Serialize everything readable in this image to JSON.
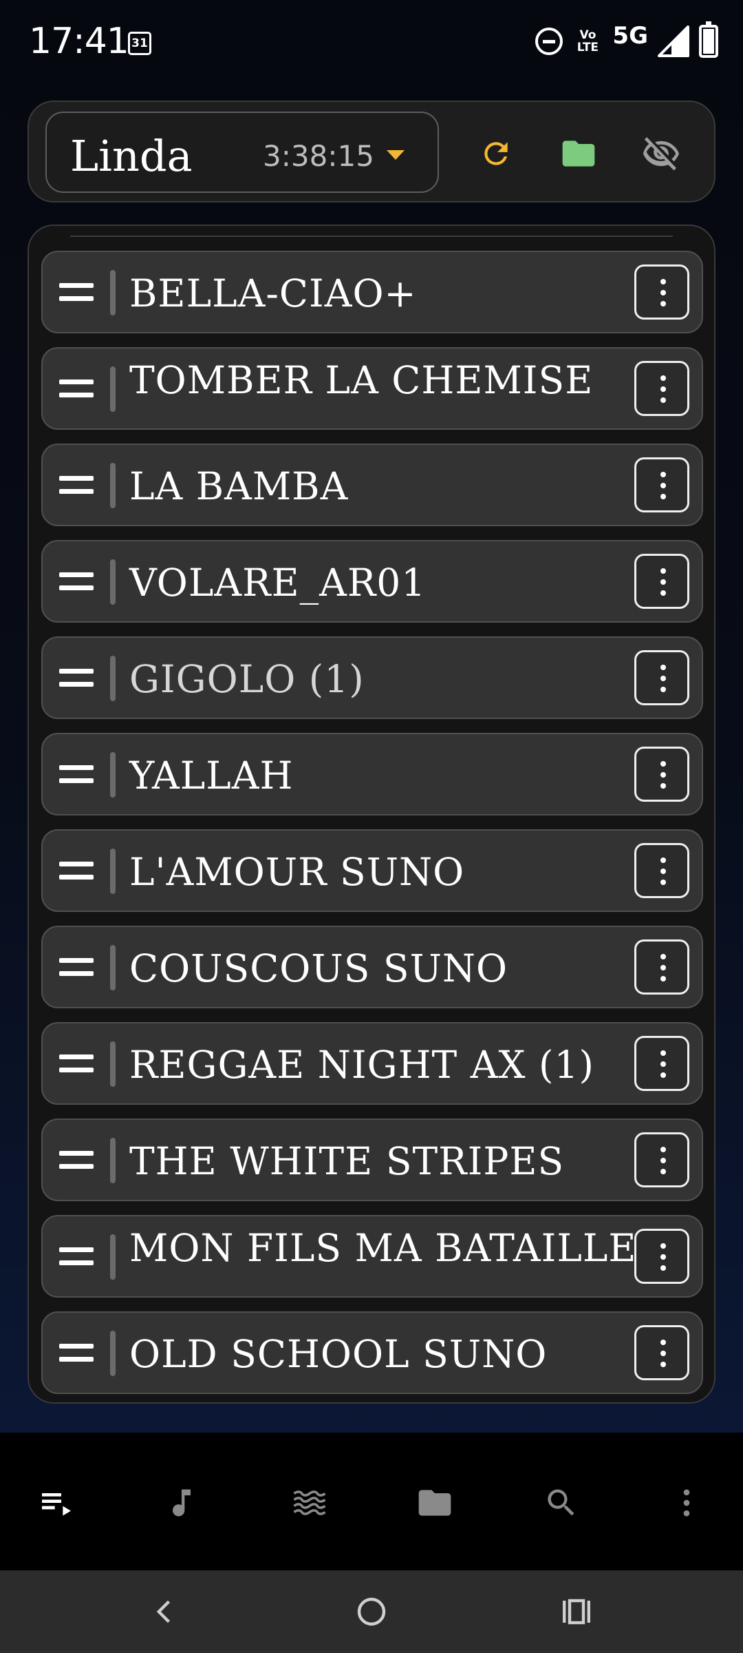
{
  "status_bar": {
    "time": "17:41",
    "calendar_day": "31",
    "volte_line1": "Vo",
    "volte_line2": "LTE",
    "network": "5G"
  },
  "header": {
    "profile_name": "Linda",
    "duration": "3:38:15",
    "colors": {
      "refresh": "#f5b731",
      "folder": "#7ccb7f",
      "hide": "#9e9e9e"
    }
  },
  "playlist": {
    "items": [
      {
        "title": "BELLA-CIAO+"
      },
      {
        "title": "TOMBER LA CHEMISE"
      },
      {
        "title": "LA BAMBA"
      },
      {
        "title": "VOLARE_AR01"
      },
      {
        "title": "GIGOLO (1)"
      },
      {
        "title": "YALLAH"
      },
      {
        "title": "L'AMOUR SUNO"
      },
      {
        "title": "COUSCOUS SUNO"
      },
      {
        "title": "REGGAE NIGHT AX (1)"
      },
      {
        "title": "THE WHITE STRIPES"
      },
      {
        "title": "MON FILS MA BATAILLE"
      },
      {
        "title": "OLD SCHOOL SUNO"
      }
    ]
  },
  "bottom_nav": {
    "items": [
      "playlist-icon",
      "music-note-icon",
      "waves-icon",
      "folder-icon",
      "search-icon",
      "more-vert-icon"
    ]
  },
  "system_nav": {
    "items": [
      "back-icon",
      "home-icon",
      "recents-icon"
    ]
  }
}
